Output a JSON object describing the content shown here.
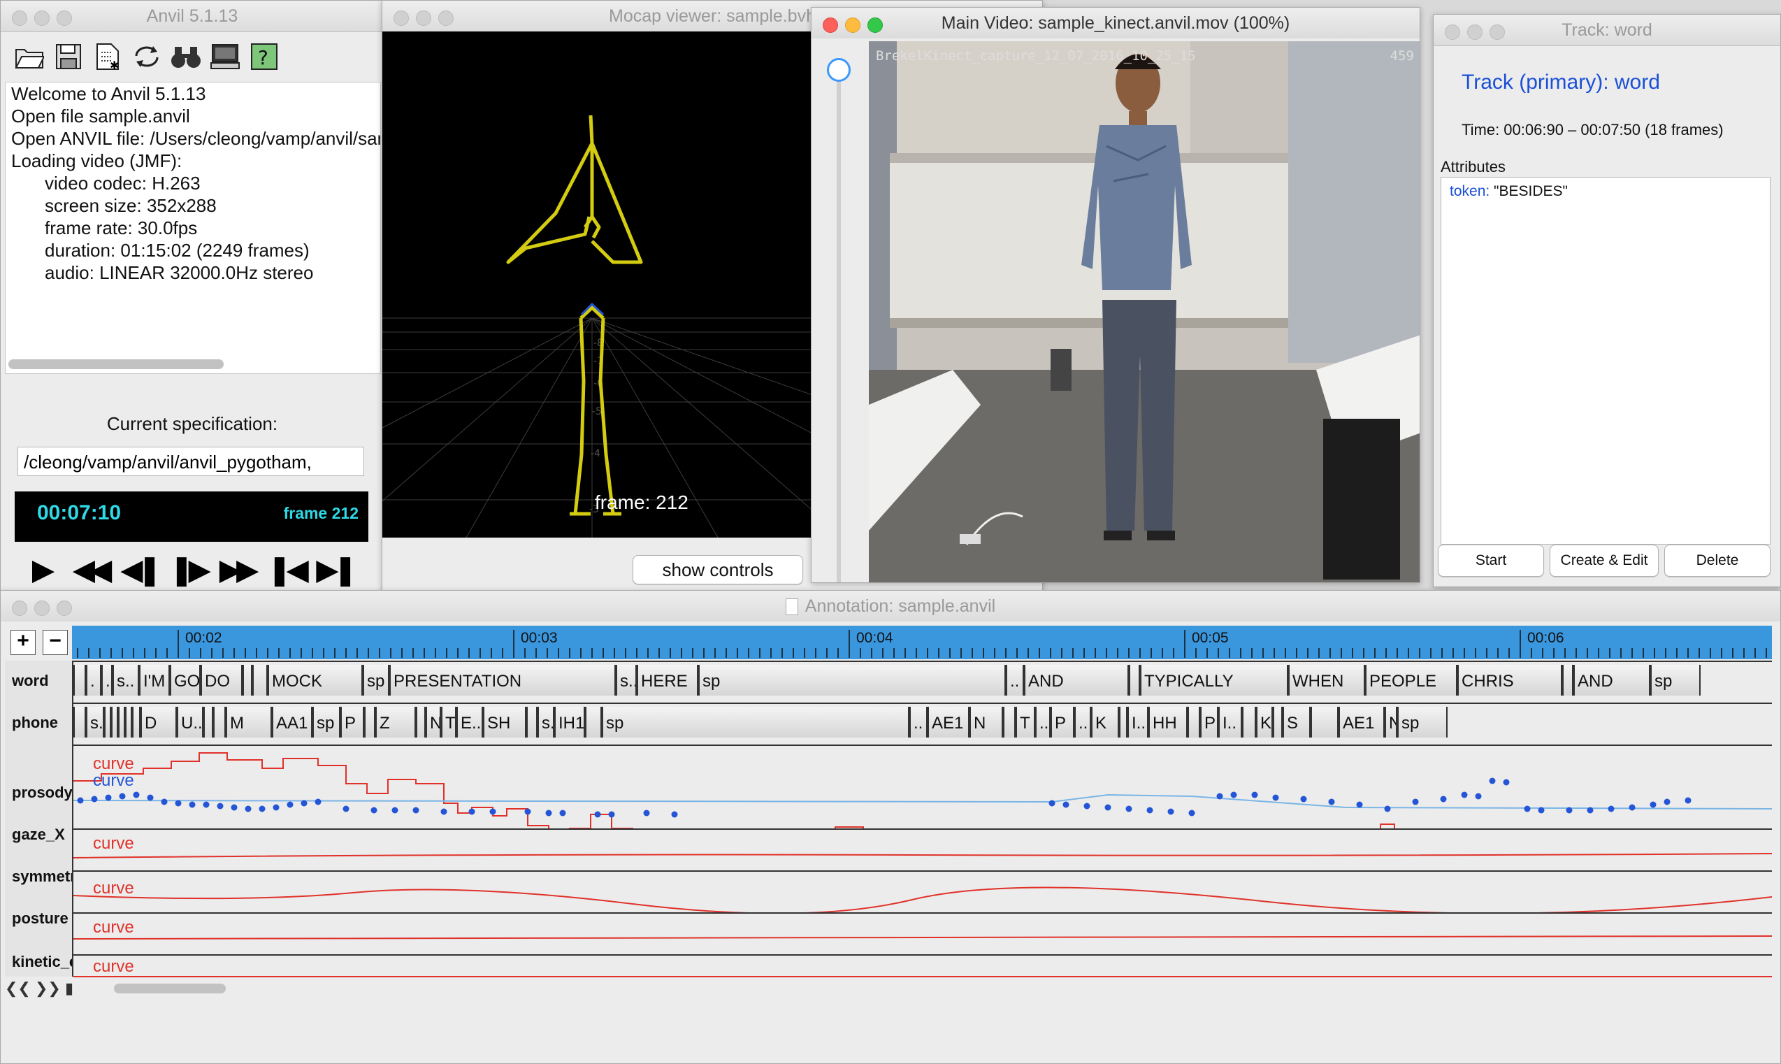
{
  "anvil_window": {
    "title": "Anvil 5.1.13",
    "toolbar_icons": [
      "open-folder-icon",
      "save-icon",
      "new-spec-icon",
      "reload-icon",
      "search-binoculars-icon",
      "monitor-icon",
      "help-icon"
    ],
    "log_lines": [
      "Welcome to Anvil 5.1.13",
      "Open file sample.anvil",
      "Open ANVIL file: /Users/cleong/vamp/anvil/sample.anvil",
      "Loading video (JMF):"
    ],
    "log_indented": [
      "video codec: H.263",
      "screen size: 352x288",
      "frame rate: 30.0fps",
      "duration: 01:15:02 (2249 frames)",
      "audio: LINEAR 32000.0Hz stereo"
    ],
    "spec_label": "Current specification:",
    "spec_path": "/cleong/vamp/anvil/anvil_pygotham,",
    "timecode": "00:07:10",
    "frame": "frame 212",
    "transport": {
      "play": "▶",
      "fast_back": "◀◀",
      "step_back": "◀❚",
      "step_fwd": "❚▶",
      "fast_fwd": "▶▶",
      "to_start": "❚◀",
      "to_end": "▶❚"
    }
  },
  "mocap_window": {
    "title": "Mocap viewer: sample.bvh",
    "frame_label": "frame: 212",
    "show_controls": "show controls"
  },
  "video_window": {
    "title": "Main Video: sample_kinect.anvil.mov (100%)",
    "caption": "BrekelKinect_capture_12_07_2016_10_25_15",
    "counter": "459"
  },
  "track_window": {
    "title": "Track: word",
    "heading": "Track (primary): word",
    "time": "Time: 00:06:90 – 00:07:50 (18 frames)",
    "attributes_label": "Attributes",
    "attr_key": "token:",
    "attr_value": " \"BESIDES\"",
    "start": "Start",
    "create_edit": "Create & Edit",
    "delete": "Delete"
  },
  "annotation_window": {
    "title": "Annotation: sample.anvil",
    "zoom_in": "+",
    "zoom_out": "−",
    "ruler": [
      "00:02",
      "00:03",
      "00:04",
      "00:05",
      "00:06"
    ],
    "track_names": [
      "word",
      "phone",
      "prosody",
      "gaze_X",
      "symmetr",
      "posture",
      "kinetic_e"
    ],
    "word_elements": [
      "",
      ".",
      ".",
      "s..",
      "I'M",
      "GO..",
      "DO",
      "",
      "",
      "MOCK",
      "sp",
      "PRESENTATION",
      "s..",
      "HERE",
      "sp",
      "..",
      "AND",
      "",
      "TYPICALLY",
      "WHEN",
      "PEOPLE",
      "CHRIS",
      "",
      "AND",
      "sp"
    ],
    "phone_elements": [
      "",
      "s..",
      "",
      "",
      "",
      "",
      "",
      "D",
      "U..",
      "",
      "",
      "M",
      "AA1",
      "sp",
      "P",
      "",
      "Z",
      "",
      "N",
      "T",
      "E..",
      "SH",
      "",
      "s..",
      "IH1",
      "",
      "sp",
      "..",
      "AE1",
      "N",
      "",
      "T",
      "..",
      "P",
      "..",
      "K",
      "",
      "I..",
      "HH",
      "",
      "P",
      "I..",
      "",
      "K",
      "",
      "S",
      "",
      "AE1",
      "N",
      "sp"
    ],
    "curve": "curve",
    "curve_blue": "curve",
    "nav_buttons": "❮❮ ❯❯ ▮"
  },
  "colors": {
    "timecode": "#2fd9e6",
    "ruler": "#3a96dd",
    "curve_red": "#e0322a",
    "curve_blue": "#2455d6",
    "skeleton": "#d4cc10"
  }
}
